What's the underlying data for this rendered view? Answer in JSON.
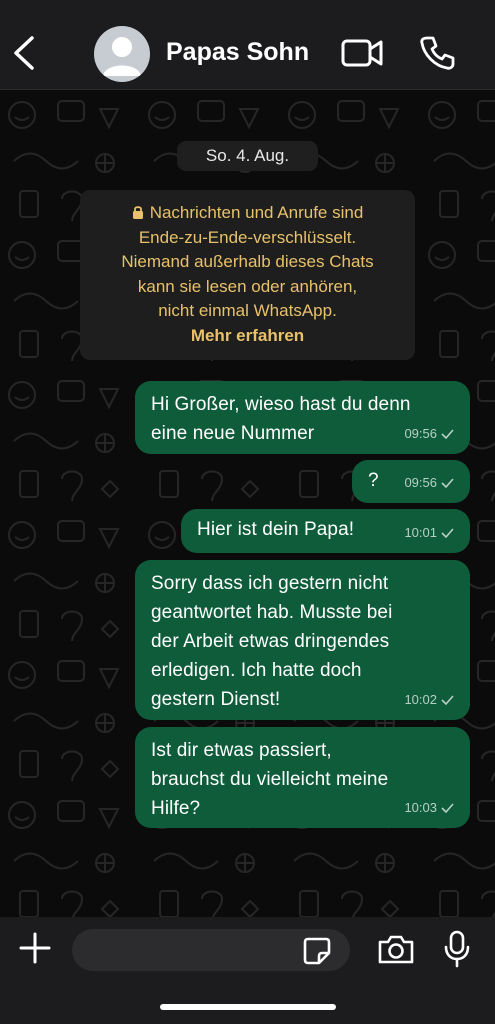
{
  "header": {
    "contact_name": "Papas Sohn",
    "back_icon": "chevron-left-icon",
    "video_icon": "video-camera-icon",
    "call_icon": "phone-icon"
  },
  "chat": {
    "date_label": "So. 4. Aug.",
    "security_notice": {
      "lines": [
        "Nachrichten und Anrufe sind",
        "Ende-zu-Ende-verschlüsselt.",
        "Niemand außerhalb dieses Chats",
        "kann sie lesen oder anhören,",
        "nicht einmal WhatsApp."
      ],
      "learn_more": "Mehr erfahren"
    },
    "messages": [
      {
        "lines": [
          "Hi Großer, wieso hast du denn",
          "eine neue Nummer"
        ],
        "time": "09:56"
      },
      {
        "lines": [
          "?"
        ],
        "time": "09:56"
      },
      {
        "lines": [
          "Hier ist dein Papa!"
        ],
        "time": "10:01"
      },
      {
        "lines": [
          "Sorry dass ich gestern nicht",
          "geantwortet hab. Musste bei",
          "der Arbeit etwas dringendes",
          "erledigen. Ich hatte doch",
          "gestern Dienst!"
        ],
        "time": "10:02"
      },
      {
        "lines": [
          "Ist dir etwas passiert,",
          "brauchst du vielleicht meine",
          "Hilfe?"
        ],
        "time": "10:03"
      }
    ]
  },
  "input_bar": {
    "placeholder": "",
    "plus_icon": "plus-icon",
    "sticker_icon": "sticker-icon",
    "camera_icon": "camera-icon",
    "mic_icon": "microphone-icon"
  },
  "colors": {
    "outgoing_bubble": "#0f5c3b",
    "notice_text": "#e8c16a",
    "header_bg": "#1c1c1e"
  }
}
